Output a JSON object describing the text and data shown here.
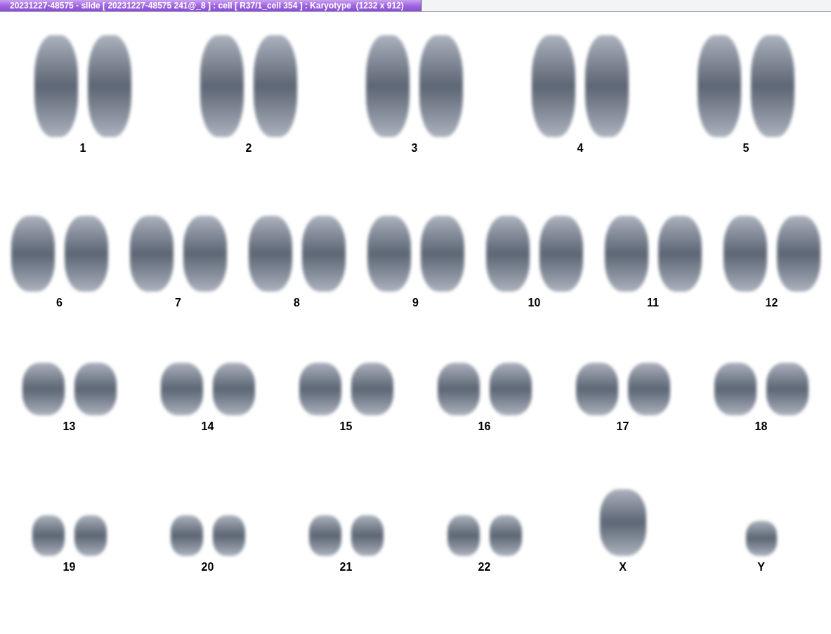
{
  "window": {
    "title": "20231227-48575 - slide [ 20231227-48575 241@_8 ] : cell [ R37/1_cell 354 ] : Karyotype  (1232 x 912)"
  },
  "karyotype": {
    "rows": [
      [
        {
          "label": "1",
          "kind": "pair"
        },
        {
          "label": "2",
          "kind": "pair"
        },
        {
          "label": "3",
          "kind": "pair"
        },
        {
          "label": "4",
          "kind": "pair"
        },
        {
          "label": "5",
          "kind": "pair"
        }
      ],
      [
        {
          "label": "6",
          "kind": "pair"
        },
        {
          "label": "7",
          "kind": "pair"
        },
        {
          "label": "8",
          "kind": "pair"
        },
        {
          "label": "9",
          "kind": "pair"
        },
        {
          "label": "10",
          "kind": "pair"
        },
        {
          "label": "11",
          "kind": "pair"
        },
        {
          "label": "12",
          "kind": "pair"
        }
      ],
      [
        {
          "label": "13",
          "kind": "pair"
        },
        {
          "label": "14",
          "kind": "pair"
        },
        {
          "label": "15",
          "kind": "pair"
        },
        {
          "label": "16",
          "kind": "pair"
        },
        {
          "label": "17",
          "kind": "pair"
        },
        {
          "label": "18",
          "kind": "pair"
        }
      ],
      [
        {
          "label": "19",
          "kind": "pair"
        },
        {
          "label": "20",
          "kind": "pair"
        },
        {
          "label": "21",
          "kind": "pair"
        },
        {
          "label": "22",
          "kind": "pair"
        },
        {
          "label": "X",
          "kind": "single"
        },
        {
          "label": "Y",
          "kind": "single"
        }
      ]
    ]
  }
}
